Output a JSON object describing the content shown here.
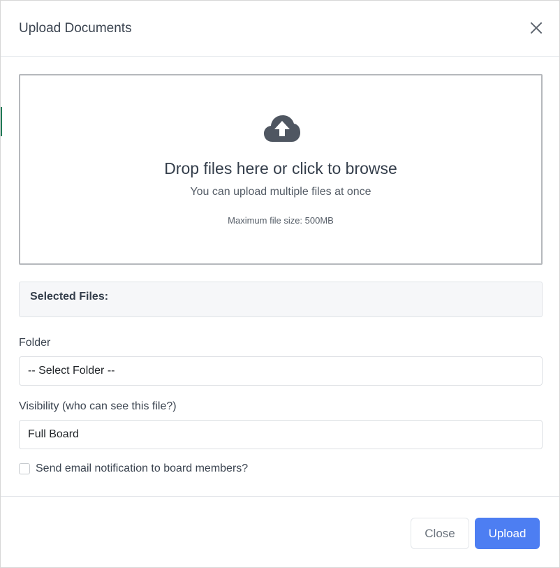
{
  "modal": {
    "title": "Upload Documents"
  },
  "dropzone": {
    "icon": "cloud-upload-icon",
    "title": "Drop files here or click to browse",
    "subtitle": "You can upload multiple files at once",
    "max_size": "Maximum file size: 500MB"
  },
  "selected_files": {
    "label": "Selected Files:"
  },
  "folder": {
    "label": "Folder",
    "value": "-- Select Folder --"
  },
  "visibility": {
    "label": "Visibility (who can see this file?)",
    "value": "Full Board"
  },
  "notify": {
    "label": "Send email notification to board members?",
    "checked": false
  },
  "footer": {
    "close_label": "Close",
    "upload_label": "Upload"
  },
  "colors": {
    "primary": "#4d7ef2",
    "icon": "#4f5661"
  }
}
